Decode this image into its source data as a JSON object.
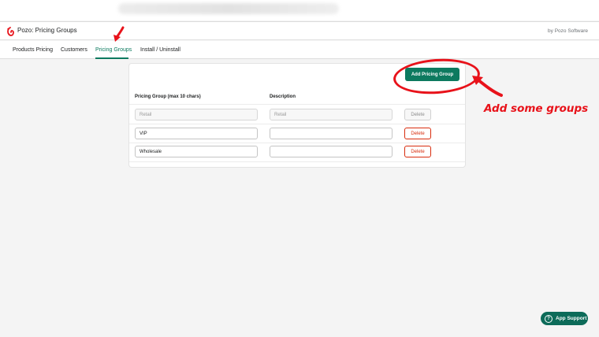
{
  "header": {
    "app_title": "Pozo: Pricing Groups",
    "byline": "by Pozo Software"
  },
  "nav": {
    "tabs": [
      {
        "label": "Products Pricing",
        "active": false
      },
      {
        "label": "Customers",
        "active": false
      },
      {
        "label": "Pricing Groups",
        "active": true
      },
      {
        "label": "Install / Uninstall",
        "active": false
      }
    ]
  },
  "main": {
    "add_button_label": "Add Pricing Group",
    "columns": {
      "group": "Pricing Group (max 10 chars)",
      "description": "Description"
    },
    "rows": [
      {
        "group": "Retail",
        "description": "Retail",
        "description_placeholder": "",
        "delete_label": "Delete",
        "disabled": true
      },
      {
        "group": "VIP",
        "description": "",
        "description_placeholder": "",
        "delete_label": "Delete",
        "disabled": false
      },
      {
        "group": "Wholesale",
        "description": "",
        "description_placeholder": "",
        "delete_label": "Delete",
        "disabled": false
      }
    ]
  },
  "annotation": {
    "text": "Add some groups",
    "color": "#e8121a"
  },
  "support": {
    "label": "App Support"
  },
  "colors": {
    "accent": "#0d7a5f",
    "danger": "#d82c0d"
  }
}
